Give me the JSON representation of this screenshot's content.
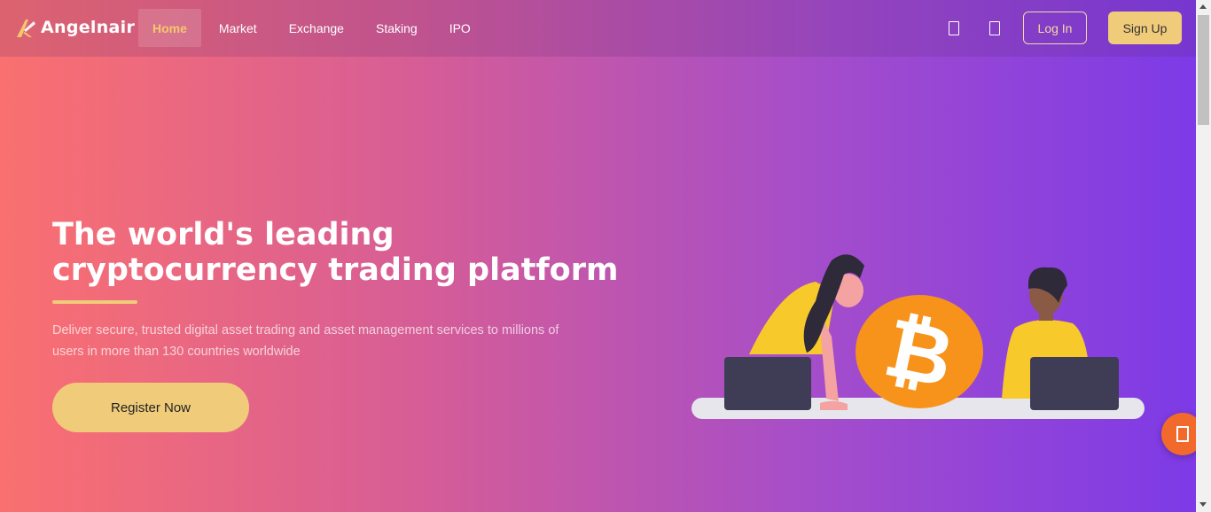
{
  "brand": {
    "name": "Angelnair",
    "logo_icon": "angel-wing-logo"
  },
  "nav": {
    "items": [
      {
        "label": "Home",
        "active": true
      },
      {
        "label": "Market",
        "active": false
      },
      {
        "label": "Exchange",
        "active": false
      },
      {
        "label": "Staking",
        "active": false
      },
      {
        "label": "IPO",
        "active": false
      }
    ],
    "icons": [
      "mobile-app-icon",
      "language-icon"
    ],
    "login_label": "Log In",
    "signup_label": "Sign Up"
  },
  "hero": {
    "title_line1": "The world's leading",
    "title_line2": "cryptocurrency trading platform",
    "description": "Deliver secure, trusted digital asset trading and asset management services to millions of users in more than 130 countries worldwide",
    "cta_label": "Register Now",
    "illustration": "two-people-trading-bitcoin-illustration"
  },
  "floating": {
    "icon": "customer-service-icon"
  },
  "colors": {
    "gradient_start": "#fa7070",
    "gradient_end": "#7d3ae6",
    "accent_gold": "#f0cb7a",
    "active_nav_text": "#f3c86f",
    "bitcoin_orange": "#f7931a",
    "float_button": "#f26a2b"
  }
}
